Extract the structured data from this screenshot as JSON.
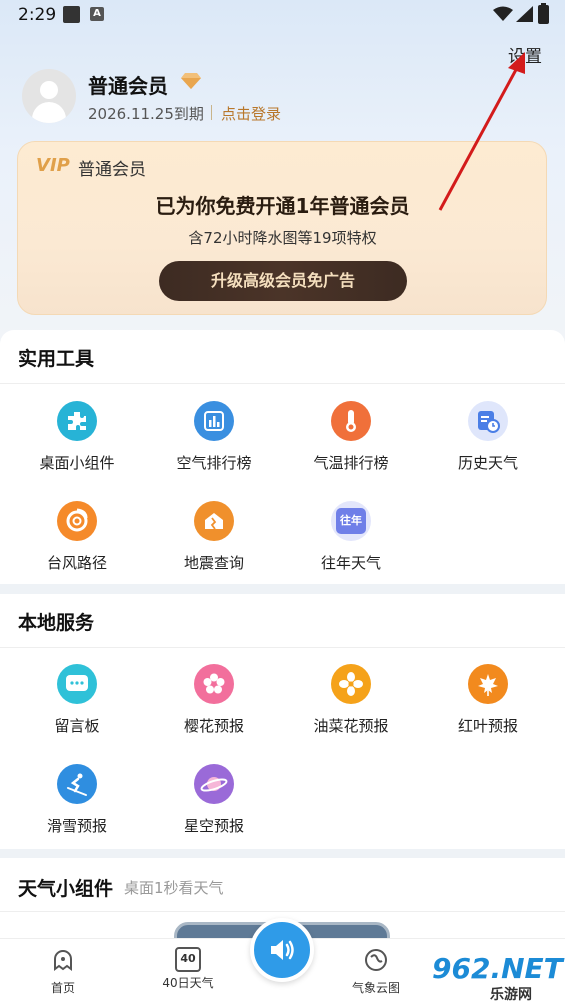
{
  "status_bar": {
    "time": "2:29",
    "notif_icon": "A"
  },
  "header": {
    "settings_label": "设置",
    "member_name": "普通会员",
    "expire_text": "2026.11.25到期",
    "login_link": "点击登录"
  },
  "vip_card": {
    "logo_prefix": "V",
    "logo_rest": "IP",
    "title": "普通会员",
    "main_text": "已为你免费开通1年普通会员",
    "sub_text": "含72小时降水图等19项特权",
    "upgrade_button": "升级高级会员免广告"
  },
  "tools": {
    "title": "实用工具",
    "items": [
      {
        "label": "桌面小组件",
        "icon": "puzzle-icon",
        "color": "#27b3d6"
      },
      {
        "label": "空气排行榜",
        "icon": "bar-chart-icon",
        "color": "#3a8fe0"
      },
      {
        "label": "气温排行榜",
        "icon": "thermometer-icon",
        "color": "#f0703a"
      },
      {
        "label": "历史天气",
        "icon": "calendar-clock-icon",
        "color": "#4a7ee6"
      },
      {
        "label": "台风路径",
        "icon": "typhoon-icon",
        "color": "#f58a2a"
      },
      {
        "label": "地震查询",
        "icon": "earthquake-icon",
        "color": "#f0902c"
      },
      {
        "label": "往年天气",
        "icon": "past-year-icon",
        "color": "#6f7fe8",
        "text": "往年"
      }
    ]
  },
  "local": {
    "title": "本地服务",
    "items": [
      {
        "label": "留言板",
        "icon": "message-board-icon",
        "color": "#2fc1d8"
      },
      {
        "label": "樱花预报",
        "icon": "cherry-blossom-icon",
        "color": "#f26f9c"
      },
      {
        "label": "油菜花预报",
        "icon": "rapeseed-flower-icon",
        "color": "#f5a21a"
      },
      {
        "label": "红叶预报",
        "icon": "red-leaf-icon",
        "color": "#f28a1e"
      },
      {
        "label": "滑雪预报",
        "icon": "skiing-icon",
        "color": "#2f8ee0"
      },
      {
        "label": "星空预报",
        "icon": "planet-icon",
        "color": "#9a6ad8"
      }
    ]
  },
  "widget_section": {
    "title": "天气小组件",
    "subtitle": "桌面1秒看天气"
  },
  "bottom_nav": {
    "items": [
      {
        "label": "首页",
        "icon": "home-icon"
      },
      {
        "label": "40日天气",
        "icon": "calendar-40-icon",
        "badge": "40"
      },
      {
        "label": "气象云图",
        "icon": "cloud-map-icon"
      }
    ]
  },
  "watermark": {
    "text": "962.NET",
    "sub": "乐游网"
  }
}
